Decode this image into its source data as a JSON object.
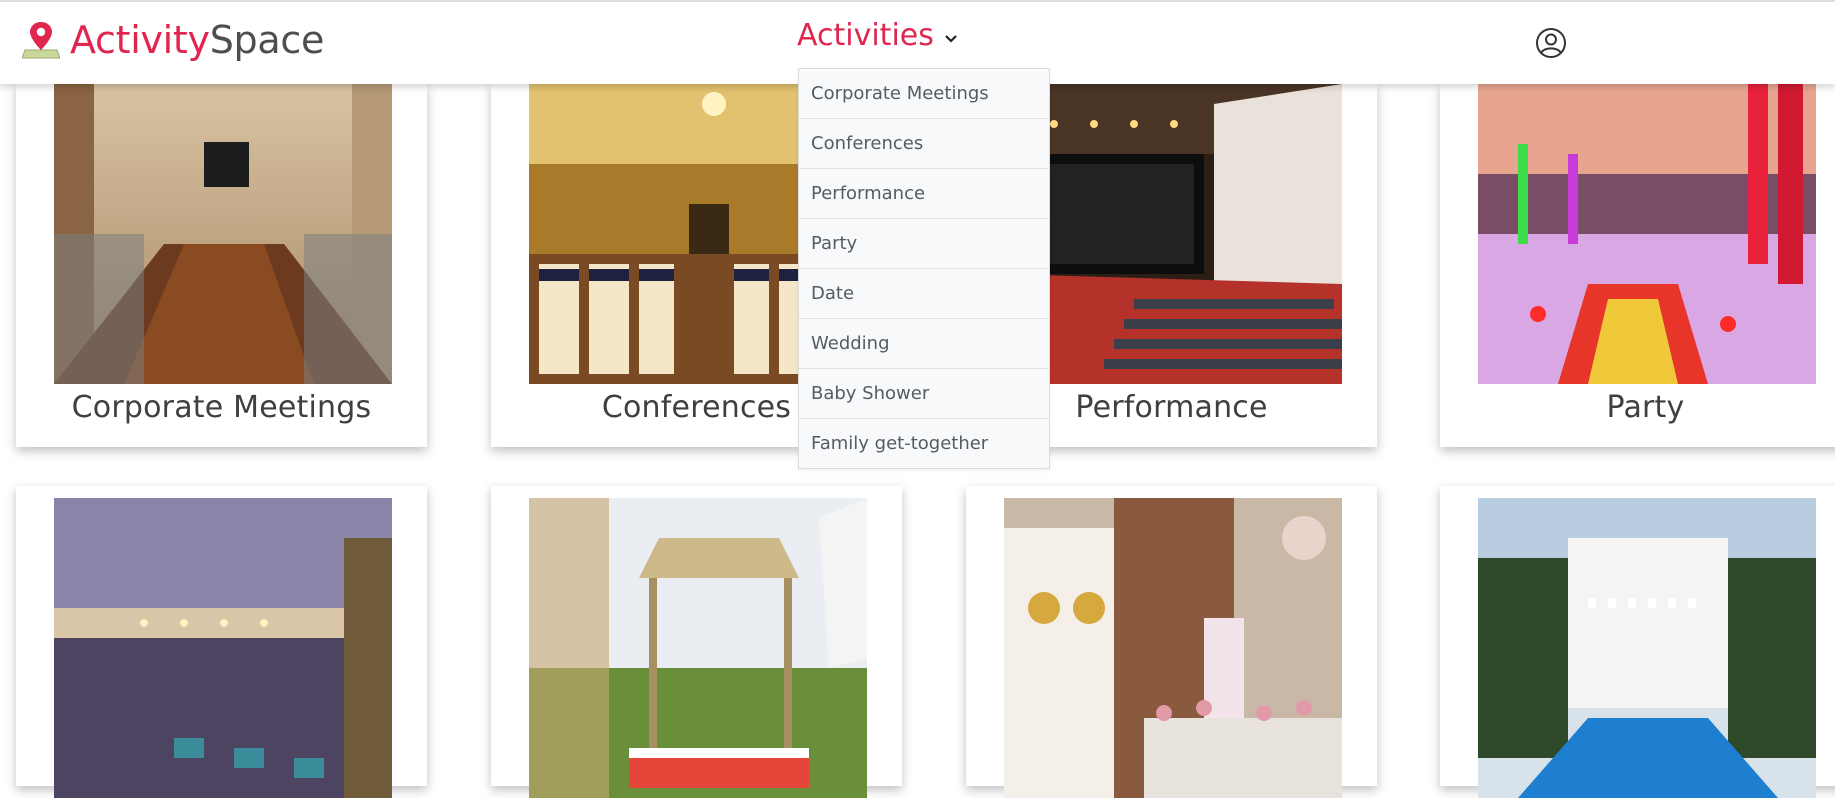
{
  "brand": {
    "part1": "Activity",
    "part2": "Space"
  },
  "header": {
    "logo_icon": "map-pin-icon",
    "nav_label": "Activities",
    "nav_icon": "chevron-down-icon",
    "user_icon": "user-circle-icon"
  },
  "dropdown": {
    "items": [
      "Corporate Meetings",
      "Conferences",
      "Performance",
      "Party",
      "Date",
      "Wedding",
      "Baby Shower",
      "Family get-together"
    ]
  },
  "cards": {
    "row1": [
      {
        "caption": "Corporate Meetings"
      },
      {
        "caption": "Conferences"
      },
      {
        "caption": "Performance"
      },
      {
        "caption": "Party"
      }
    ]
  },
  "colors": {
    "accent": "#e0254f",
    "brand_dark": "#4e4e4e",
    "dropdown_bg": "#f8f9fa"
  }
}
